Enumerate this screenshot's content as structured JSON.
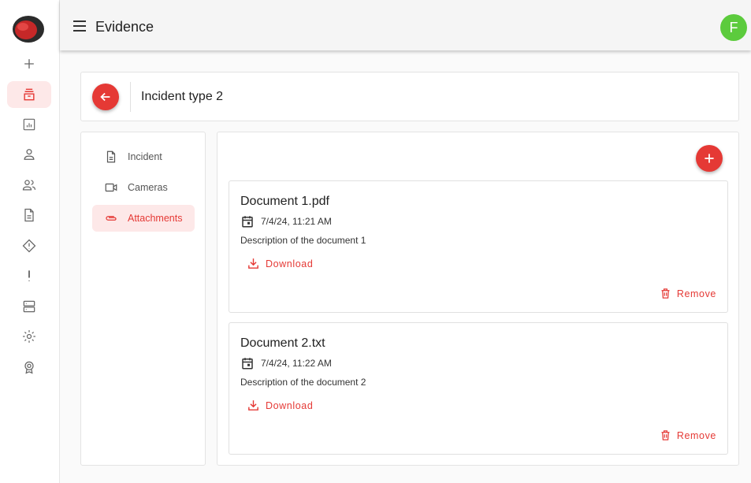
{
  "app": {
    "title": "Evidence",
    "avatar_initial": "F",
    "accent_color": "#e53935",
    "avatar_color": "#5ccb3d"
  },
  "rail": {
    "items": [
      {
        "icon": "plus-icon",
        "active": false
      },
      {
        "icon": "archive-icon",
        "active": true
      },
      {
        "icon": "chart-icon",
        "active": false
      },
      {
        "icon": "person-icon",
        "active": false
      },
      {
        "icon": "people-icon",
        "active": false
      },
      {
        "icon": "document-icon",
        "active": false
      },
      {
        "icon": "diamond-alert-icon",
        "active": false
      },
      {
        "icon": "exclamation-icon",
        "active": false
      },
      {
        "icon": "server-icon",
        "active": false
      },
      {
        "icon": "gear-icon",
        "active": false
      },
      {
        "icon": "badge-icon",
        "active": false
      }
    ]
  },
  "header": {
    "title": "Incident type 2"
  },
  "tabs": [
    {
      "label": "Incident",
      "icon": "document-icon",
      "active": false
    },
    {
      "label": "Cameras",
      "icon": "video-camera-icon",
      "active": false
    },
    {
      "label": "Attachments",
      "icon": "paperclip-icon",
      "active": true
    }
  ],
  "attachments": [
    {
      "name": "Document 1.pdf",
      "date": "7/4/24, 11:21 AM",
      "description": "Description of the document 1",
      "download_label": "Download",
      "remove_label": "Remove"
    },
    {
      "name": "Document 2.txt",
      "date": "7/4/24, 11:22 AM",
      "description": "Description of the document 2",
      "download_label": "Download",
      "remove_label": "Remove"
    }
  ]
}
